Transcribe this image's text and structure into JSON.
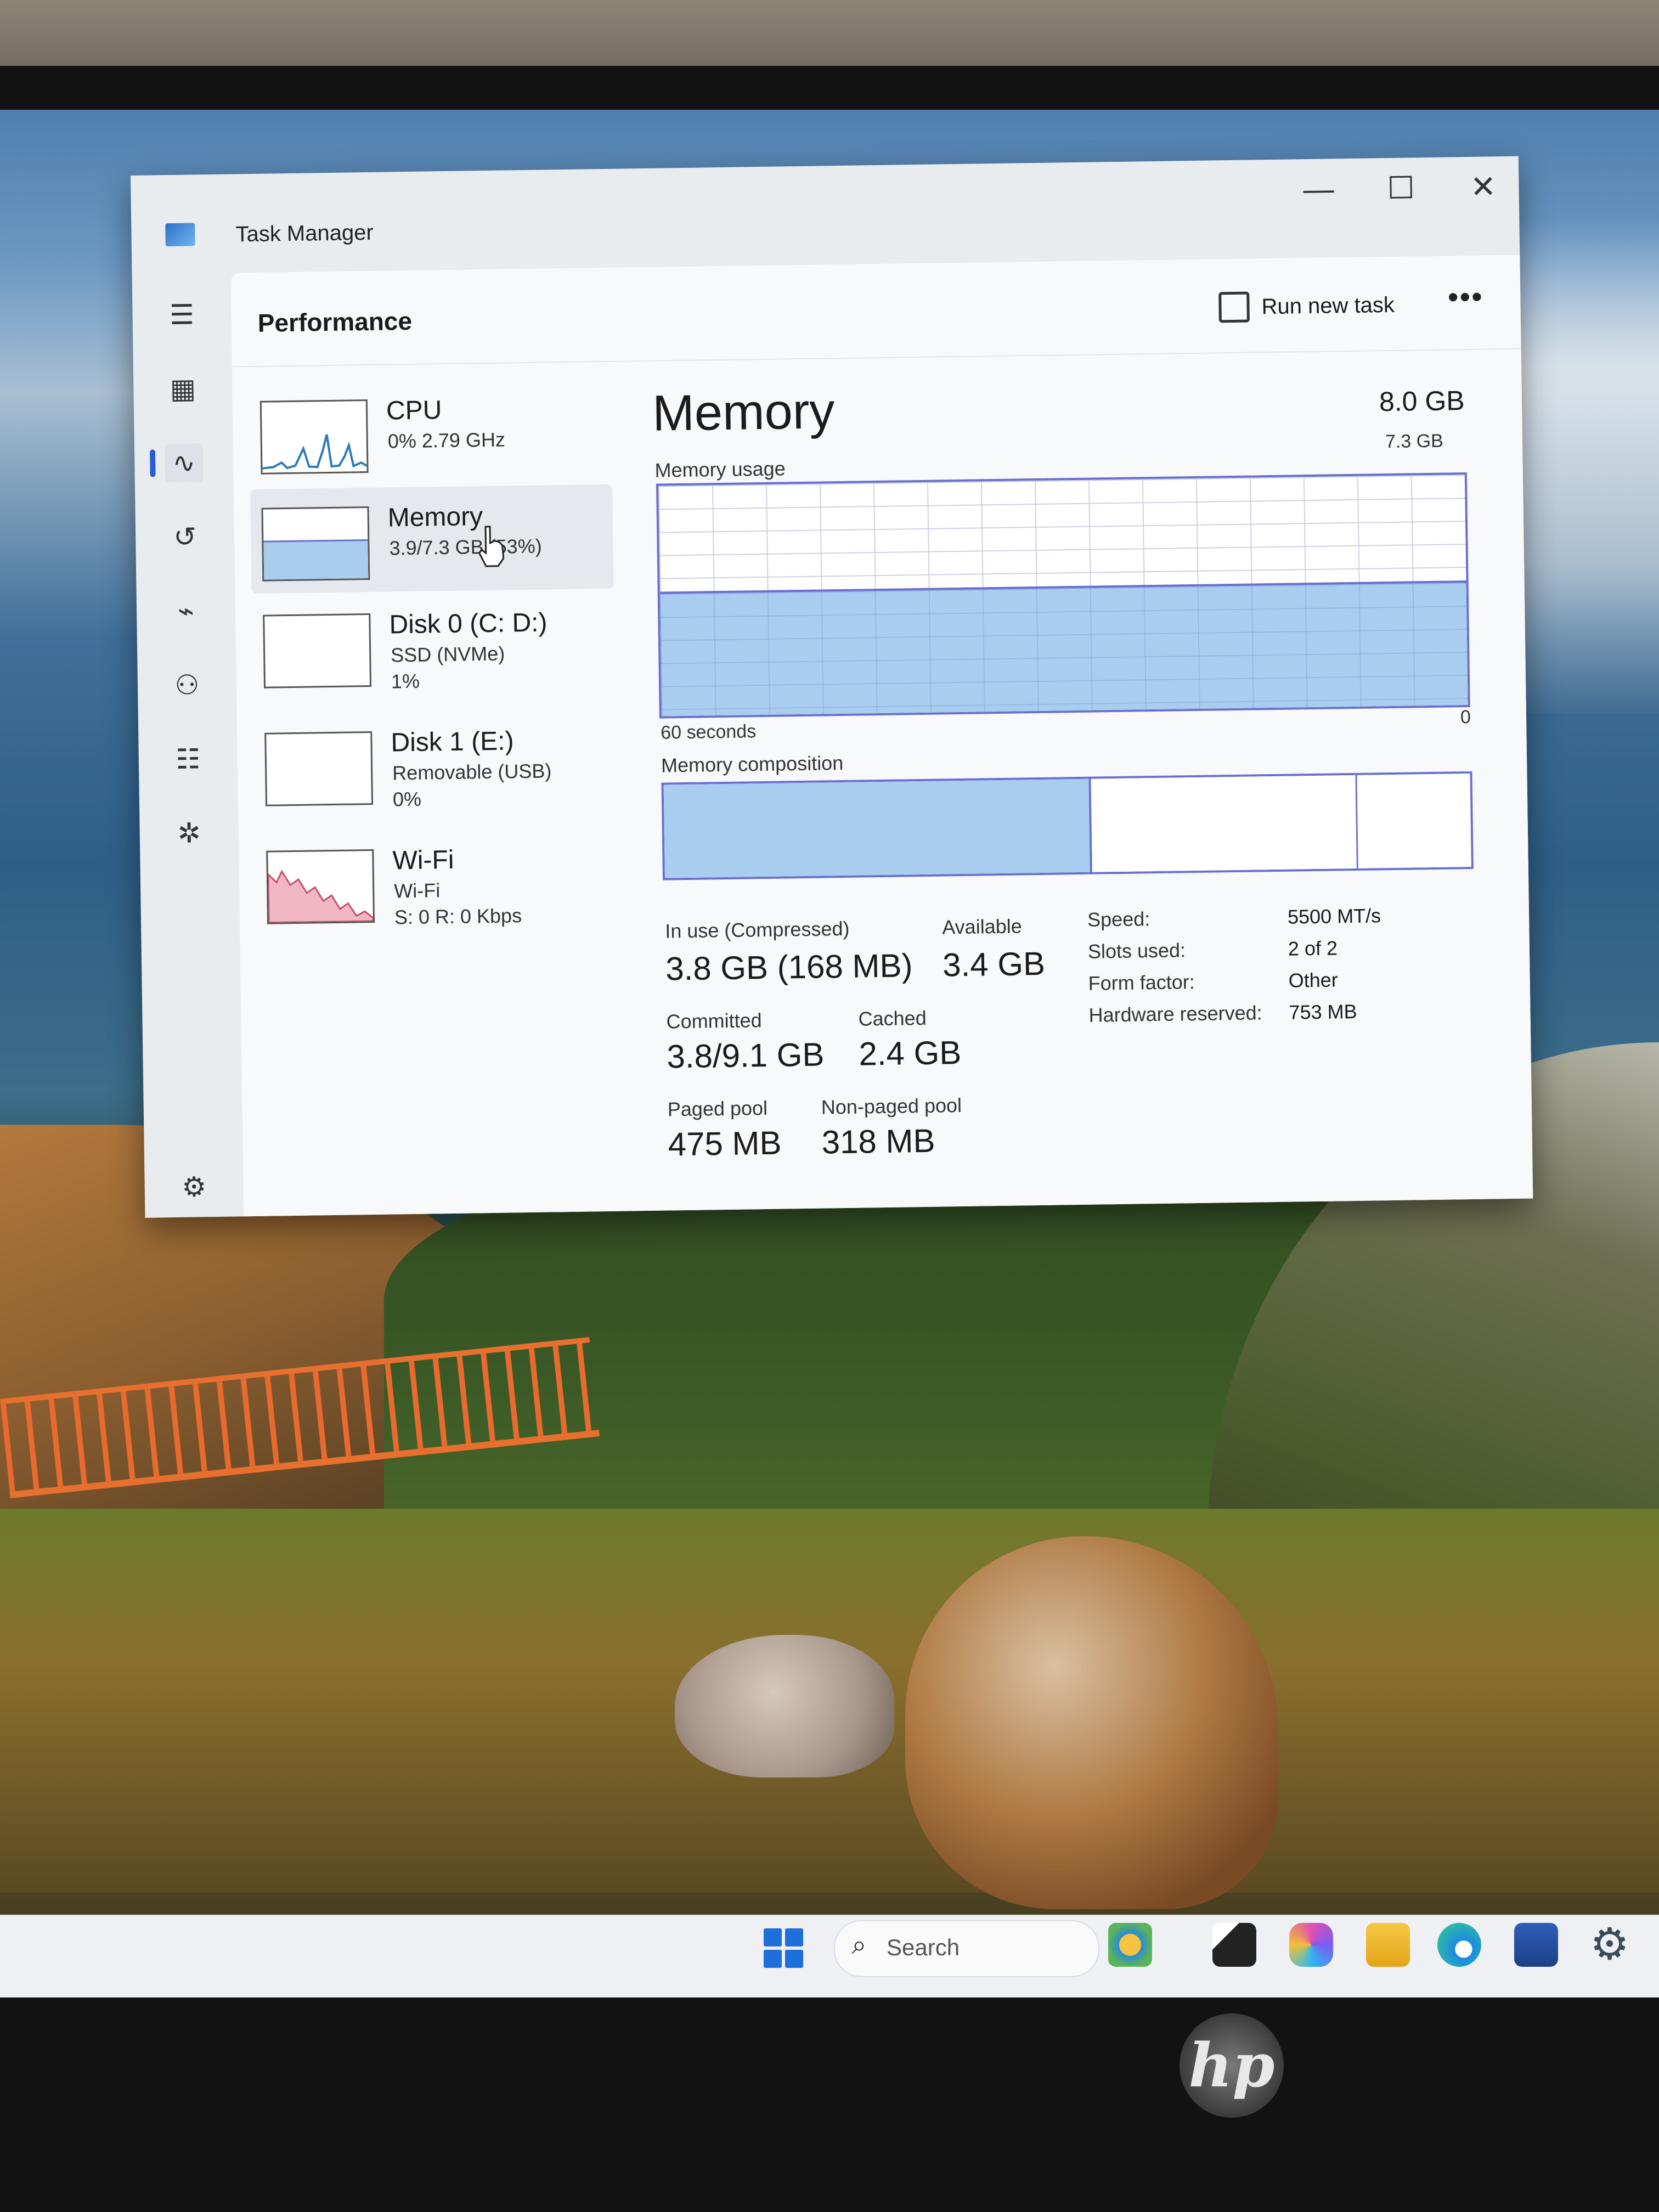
{
  "window": {
    "title": "Task Manager",
    "minimize_glyph": "—",
    "maximize_glyph": "☐",
    "close_glyph": "✕"
  },
  "nav": {
    "menu_icon": "hamburger-icon",
    "items": [
      "processes-icon",
      "performance-icon",
      "app-history-icon",
      "startup-apps-icon",
      "users-icon",
      "details-icon",
      "services-icon"
    ],
    "settings_icon": "settings-icon"
  },
  "header": {
    "page_title": "Performance",
    "run_new_task": "Run new task",
    "more": "•••"
  },
  "devices": [
    {
      "name": "CPU",
      "line2": "0% 2.79 GHz",
      "line3": ""
    },
    {
      "name": "Memory",
      "line2": "3.9/7.3 GB (53%)",
      "line3": ""
    },
    {
      "name": "Disk 0 (C: D:)",
      "line2": "SSD (NVMe)",
      "line3": "1%"
    },
    {
      "name": "Disk 1 (E:)",
      "line2": "Removable (USB)",
      "line3": "0%"
    },
    {
      "name": "Wi-Fi",
      "line2": "Wi-Fi",
      "line3": "S: 0 R: 0 Kbps"
    }
  ],
  "memory": {
    "title": "Memory",
    "total": "8.0 GB",
    "usage_label": "Memory usage",
    "usage_max": "7.3 GB",
    "usage_fraction": 0.53,
    "axis_left": "60 seconds",
    "axis_right": "0",
    "composition_label": "Memory composition",
    "composition": {
      "in_use_fraction": 0.53,
      "modified_fraction": 0.0,
      "standby_fraction": 0.33,
      "free_fraction": 0.14
    },
    "stats": {
      "in_use_label": "In use (Compressed)",
      "in_use_value": "3.8 GB (168 MB)",
      "available_label": "Available",
      "available_value": "3.4 GB",
      "committed_label": "Committed",
      "committed_value": "3.8/9.1 GB",
      "cached_label": "Cached",
      "cached_value": "2.4 GB",
      "paged_pool_label": "Paged pool",
      "paged_pool_value": "475 MB",
      "non_paged_pool_label": "Non-paged pool",
      "non_paged_pool_value": "318 MB"
    },
    "specs": [
      {
        "label": "Speed:",
        "value": "5500 MT/s"
      },
      {
        "label": "Slots used:",
        "value": "2 of 2"
      },
      {
        "label": "Form factor:",
        "value": "Other"
      },
      {
        "label": "Hardware reserved:",
        "value": "753 MB"
      }
    ]
  },
  "taskbar": {
    "search_placeholder": "Search"
  },
  "colors": {
    "accent": "#6a6fd0",
    "memory_fill": "#a9cdef",
    "cpu_line": "#2b7bb9",
    "wifi_fill": "#f1b7c4"
  }
}
